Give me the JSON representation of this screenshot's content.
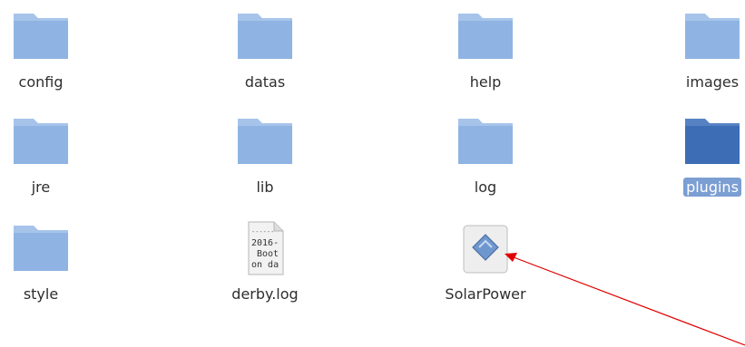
{
  "items": [
    {
      "name": "config",
      "type": "folder",
      "selected": false
    },
    {
      "name": "datas",
      "type": "folder",
      "selected": false
    },
    {
      "name": "help",
      "type": "folder",
      "selected": false
    },
    {
      "name": "images",
      "type": "folder",
      "selected": false
    },
    {
      "name": "jre",
      "type": "folder",
      "selected": false
    },
    {
      "name": "lib",
      "type": "folder",
      "selected": false
    },
    {
      "name": "log",
      "type": "folder",
      "selected": false
    },
    {
      "name": "plugins",
      "type": "folder",
      "selected": true
    },
    {
      "name": "style",
      "type": "folder",
      "selected": false
    },
    {
      "name": "derby.log",
      "type": "text-file",
      "selected": false,
      "preview": [
        "------",
        "2016-",
        "Boot",
        "on da"
      ]
    },
    {
      "name": "SolarPower",
      "type": "executable",
      "selected": false
    }
  ],
  "colors": {
    "folder": "#8fb4e3",
    "folder_tab": "#a6c4ea",
    "folder_selected": "#3d6db5",
    "folder_selected_tab": "#5682c4",
    "selection_label_bg": "#7b9ed3",
    "annotation_arrow": "#e00000"
  }
}
